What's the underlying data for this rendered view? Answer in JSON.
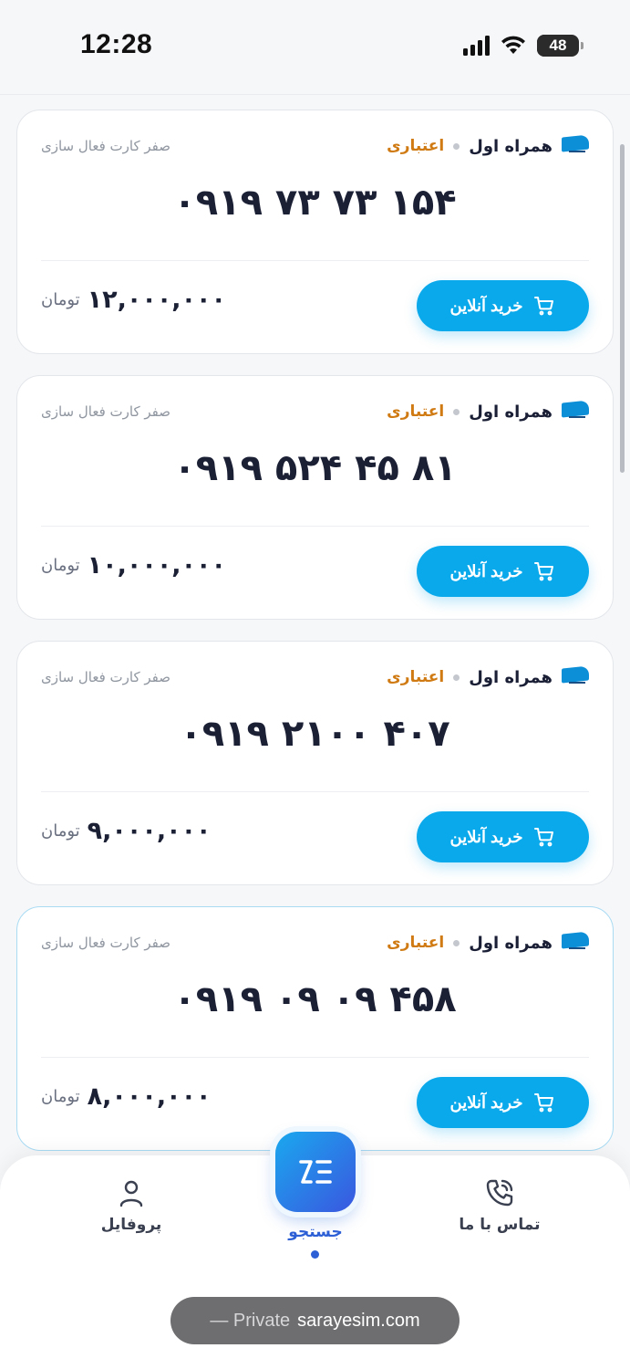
{
  "status_bar": {
    "time": "12:28",
    "battery": "48",
    "icons": [
      "signal-icon",
      "wifi-icon",
      "battery-icon"
    ]
  },
  "listings": [
    {
      "operator": "همراه اول",
      "sim_type": "اعتباری",
      "activation": "صفر کارت فعال سازی",
      "number": "۰۹۱۹ ۷۳ ۷۳ ۱۵۴",
      "price": "۱۲,۰۰۰,۰۰۰",
      "currency": "تومان",
      "buy_label": "خرید آنلاین"
    },
    {
      "operator": "همراه اول",
      "sim_type": "اعتباری",
      "activation": "صفر کارت فعال سازی",
      "number": "۰۹۱۹ ۵۲۴ ۴۵ ۸۱",
      "price": "۱۰,۰۰۰,۰۰۰",
      "currency": "تومان",
      "buy_label": "خرید آنلاین"
    },
    {
      "operator": "همراه اول",
      "sim_type": "اعتباری",
      "activation": "صفر کارت فعال سازی",
      "number": "۰۹۱۹ ۲۱۰۰ ۴۰۷",
      "price": "۹,۰۰۰,۰۰۰",
      "currency": "تومان",
      "buy_label": "خرید آنلاین"
    },
    {
      "operator": "همراه اول",
      "sim_type": "اعتباری",
      "activation": "صفر کارت فعال سازی",
      "number": "۰۹۱۹ ۰۹ ۰۹ ۴۵۸",
      "price": "۸,۰۰۰,۰۰۰",
      "currency": "تومان",
      "buy_label": "خرید آنلاین"
    }
  ],
  "bottom_nav": {
    "profile_label": "پروفایل",
    "search_label": "جستجو",
    "contact_label": "تماس با ما",
    "active_tab": "search"
  },
  "browser": {
    "private_label": "— Private",
    "domain": "sarayesim.com"
  },
  "colors": {
    "accent": "#0aa9ec",
    "sim_type": "#cf7a12",
    "nav_active": "#2c5fd6"
  }
}
